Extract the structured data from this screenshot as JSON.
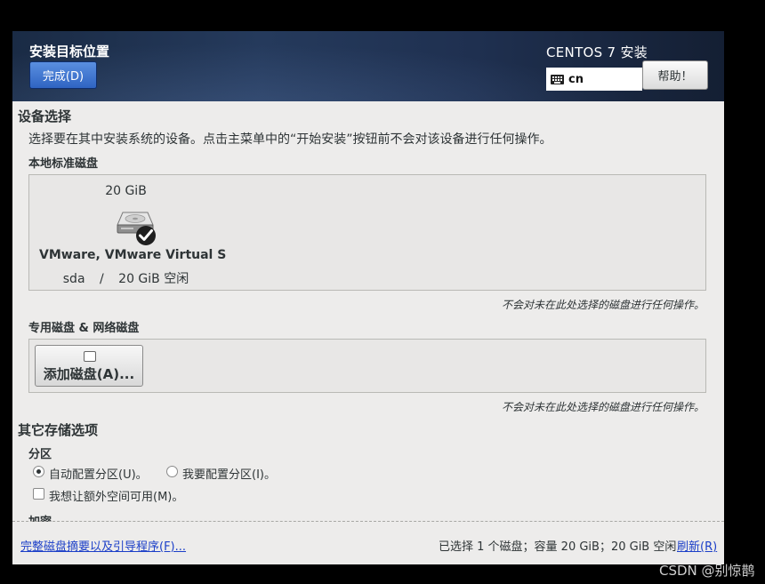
{
  "header": {
    "title": "安装目标位置",
    "done_label": "完成(D)",
    "product": "CENTOS 7 安装",
    "keyboard_layout": "cn",
    "help_label": "帮助！"
  },
  "device_selection": {
    "title": "设备选择",
    "description": "选择要在其中安装系统的设备。点击主菜单中的“开始安装”按钮前不会对该设备进行任何操作。",
    "local_disks": {
      "title": "本地标准磁盘",
      "disks": [
        {
          "size": "20 GiB",
          "name": "VMware, VMware Virtual S",
          "device": "sda",
          "separator": "/",
          "free": "20 GiB 空闲",
          "selected": true
        }
      ],
      "note": "不会对未在此处选择的磁盘进行任何操作。"
    },
    "special_disks": {
      "title": "专用磁盘 & 网络磁盘",
      "add_disk_label": "添加磁盘(A)...",
      "note": "不会对未在此处选择的磁盘进行任何操作。"
    }
  },
  "other_storage": {
    "title": "其它存储选项",
    "partitioning": {
      "title": "分区",
      "auto_label": "自动配置分区(U)。",
      "manual_label": "我要配置分区(I)。",
      "selected": "auto",
      "extra_space_label": "我想让额外空间可用(M)。",
      "extra_space_checked": false
    },
    "encryption_title": "加密"
  },
  "footer": {
    "summary_link": "完整磁盘摘要以及引导程序(F)...",
    "status": "已选择 1 个磁盘；容量 20 GiB；20 GiB 空闲",
    "refresh_link": "刷新(R)"
  },
  "watermark": "CSDN @别惊鹊",
  "colors": {
    "header_bg": "#1f3050",
    "done_button": "#3a6fcf",
    "link": "#1c3fc8",
    "panel_bg": "#edeceb"
  },
  "icons": [
    "keyboard-icon",
    "hard-disk-icon",
    "selected-check-icon",
    "add-disk-icon"
  ]
}
